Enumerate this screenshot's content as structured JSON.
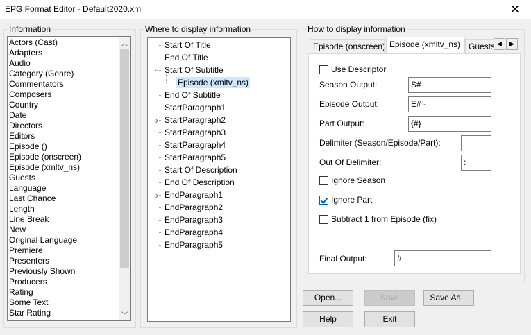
{
  "window": {
    "title": "EPG Format Editor - Default2020.xml",
    "close_icon": "close-icon"
  },
  "information": {
    "label": "Information",
    "items": [
      "Actors (Cast)",
      "Adapters",
      "Audio",
      "Category (Genre)",
      "Commentators",
      "Composers",
      "Country",
      "Date",
      "Directors",
      "Editors",
      "Episode ()",
      "Episode (onscreen)",
      "Episode (xmltv_ns)",
      "Guests",
      "Language",
      "Last Chance",
      "Length",
      "Line Break",
      "New",
      "Original Language",
      "Premiere",
      "Presenters",
      "Previously Shown",
      "Producers",
      "Rating",
      "Some Text",
      "Star Rating"
    ]
  },
  "where": {
    "label": "Where to display information",
    "items": [
      {
        "label": "Start Of Title"
      },
      {
        "label": "End Of Title"
      },
      {
        "label": "Start Of Subtitle",
        "expander": "expanded"
      },
      {
        "label": "Episode (xmltv_ns)",
        "child": true,
        "selected": true
      },
      {
        "label": "End Of Subtitle"
      },
      {
        "label": "StartParagraph1"
      },
      {
        "label": "StartParagraph2",
        "expander": "collapsed"
      },
      {
        "label": "StartParagraph3"
      },
      {
        "label": "StartParagraph4"
      },
      {
        "label": "StartParagraph5"
      },
      {
        "label": "Start Of Description"
      },
      {
        "label": "End Of Description"
      },
      {
        "label": "EndParagraph1",
        "expander": "collapsed"
      },
      {
        "label": "EndParagraph2"
      },
      {
        "label": "EndParagraph3"
      },
      {
        "label": "EndParagraph4"
      },
      {
        "label": "EndParagraph5"
      }
    ]
  },
  "how": {
    "label": "How to display information",
    "tabs": [
      "Episode (onscreen)",
      "Episode (xmltv_ns)",
      "Guests"
    ],
    "active_tab": 1,
    "use_descriptor": {
      "label": "Use Descriptor",
      "checked": false
    },
    "season_output": {
      "label": "Season Output:",
      "value": "S#"
    },
    "episode_output": {
      "label": "Episode Output:",
      "value": "E# -"
    },
    "part_output": {
      "label": "Part Output:",
      "value": "{#}"
    },
    "delimiter": {
      "label": "Delimiter (Season/Episode/Part):",
      "value": ""
    },
    "out_delimiter": {
      "label": "Out Of Delimiter:",
      "value": ":"
    },
    "ignore_season": {
      "label": "Ignore Season",
      "checked": false
    },
    "ignore_part": {
      "label": "Ignore Part",
      "checked": true
    },
    "subtract": {
      "label": "Subtract 1 from Episode (fix)",
      "checked": false
    },
    "final_output": {
      "label": "Final Output:",
      "value": "#"
    }
  },
  "buttons": {
    "open": "Open...",
    "save": "Save",
    "save_as": "Save As...",
    "help": "Help",
    "exit": "Exit"
  }
}
